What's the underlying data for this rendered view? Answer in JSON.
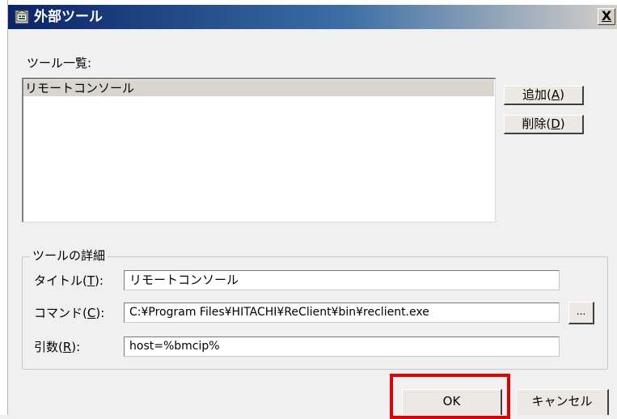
{
  "window": {
    "title": "外部ツール",
    "close_label": "X",
    "title_gradient_start": "#0a246a",
    "title_gradient_end": "#d4d0c8"
  },
  "tool_list": {
    "label": "ツール一覧:",
    "items": [
      "リモートコンソール"
    ],
    "selected_index": 0
  },
  "buttons": {
    "add": {
      "text": "追加(",
      "key": "A",
      "close": ")"
    },
    "delete": {
      "text": "削除(",
      "key": "D",
      "close": ")"
    },
    "browse": "...",
    "ok": "OK",
    "cancel": "キャンセル"
  },
  "details": {
    "legend": "ツールの詳細",
    "title_label": {
      "text": "タイトル(",
      "key": "T",
      "close": "):"
    },
    "title_value": "リモートコンソール",
    "command_label": {
      "text": "コマンド(",
      "key": "C",
      "close": "):"
    },
    "command_value": "C:¥Program Files¥HITACHI¥ReClient¥bin¥reclient.exe",
    "args_label": {
      "text": "引数(",
      "key": "R",
      "close": "):"
    },
    "args_value": "host=%bmcip%"
  },
  "highlight": {
    "target": "ok-button",
    "color": "#e00000"
  }
}
